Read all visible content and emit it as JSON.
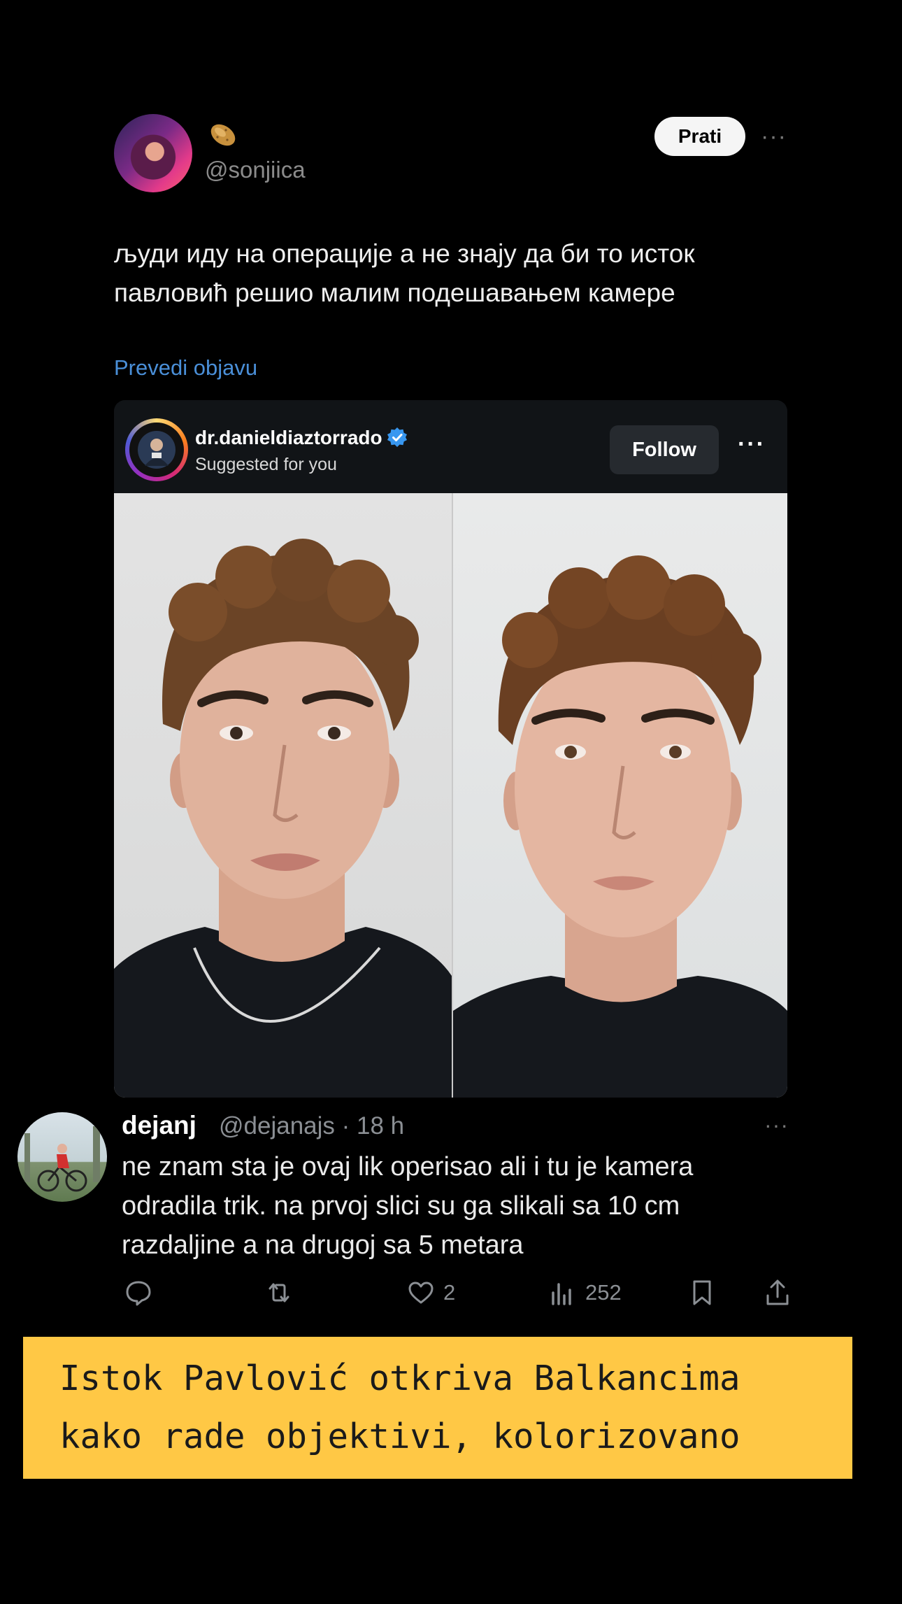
{
  "post": {
    "handle": "@sonjiica",
    "follow_label": "Prati",
    "more_label": "···",
    "text_lines": [
      "људи иду на операције а не знају да би то исток",
      "павловић решио малим подешавањем камере"
    ],
    "translate_label": "Prevedi objavu"
  },
  "embed": {
    "username": "dr.danieldiaztorrado",
    "subtitle": "Suggested for you",
    "follow_label": "Follow",
    "more_label": "···"
  },
  "reply": {
    "name": "dejanj",
    "meta": "@dejanajs · 18 h",
    "more_label": "···",
    "text_lines": [
      "ne znam sta je ovaj lik operisao ali i tu je kamera",
      "odradila trik. na prvoj slici su ga slikali sa 10 cm",
      "razdaljine a na drugoj sa 5 metara"
    ],
    "actions": {
      "reply_count": "",
      "repost_count": "",
      "like_count": "2",
      "views_count": "252"
    }
  },
  "banner": {
    "lines": [
      "Istok Pavlović otkriva Balkancima",
      "kako rade objektivi, kolorizovano"
    ]
  },
  "colors": {
    "background": "#000000",
    "link_blue": "#4a8fd8",
    "banner_yellow": "#ffc845",
    "verified_blue": "#3897f0"
  }
}
